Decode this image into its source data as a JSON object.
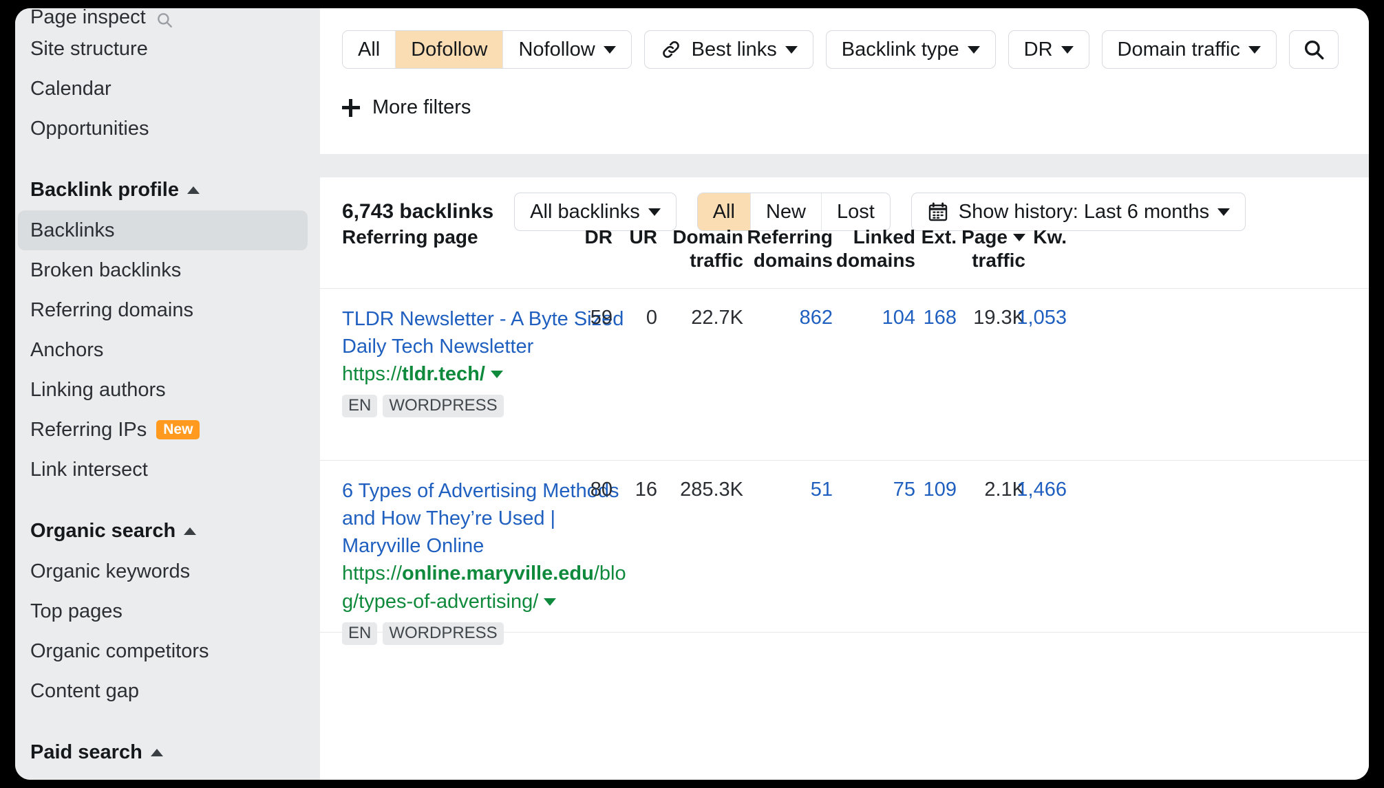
{
  "sidebar": {
    "items": [
      {
        "label": "Page inspect",
        "icon": "search-icon",
        "type": "item",
        "partial": true
      },
      {
        "label": "Site structure",
        "type": "item"
      },
      {
        "label": "Calendar",
        "type": "item"
      },
      {
        "label": "Opportunities",
        "type": "item"
      },
      {
        "label": "Backlink profile",
        "type": "header",
        "expanded": true
      },
      {
        "label": "Backlinks",
        "type": "item",
        "active": true
      },
      {
        "label": "Broken backlinks",
        "type": "item"
      },
      {
        "label": "Referring domains",
        "type": "item"
      },
      {
        "label": "Anchors",
        "type": "item"
      },
      {
        "label": "Linking authors",
        "type": "item"
      },
      {
        "label": "Referring IPs",
        "type": "item",
        "badge": "New"
      },
      {
        "label": "Link intersect",
        "type": "item"
      },
      {
        "label": "Organic search",
        "type": "header",
        "expanded": true
      },
      {
        "label": "Organic keywords",
        "type": "item"
      },
      {
        "label": "Top pages",
        "type": "item"
      },
      {
        "label": "Organic competitors",
        "type": "item"
      },
      {
        "label": "Content gap",
        "type": "item"
      },
      {
        "label": "Paid search",
        "type": "header",
        "expanded": true
      }
    ]
  },
  "filters": {
    "follow_segments": [
      {
        "label": "All",
        "selected": false
      },
      {
        "label": "Dofollow",
        "selected": true
      },
      {
        "label": "Nofollow",
        "selected": false,
        "caret": true
      }
    ],
    "best_links": {
      "label": "Best links",
      "icon": "link-icon",
      "caret": true
    },
    "backlink_type": {
      "label": "Backlink type",
      "caret": true
    },
    "dr": {
      "label": "DR",
      "caret": true
    },
    "domain_traffic": {
      "label": "Domain traffic",
      "caret": true
    },
    "search_button": {
      "icon": "search-icon"
    },
    "more_filters": {
      "label": "More filters",
      "icon": "plus-icon"
    }
  },
  "table_toolbar": {
    "count_label": "6,743 backlinks",
    "scope_dropdown": {
      "label": "All backlinks",
      "caret": true
    },
    "state_segments": [
      {
        "label": "All",
        "selected": true
      },
      {
        "label": "New",
        "selected": false
      },
      {
        "label": "Lost",
        "selected": false
      }
    ],
    "history_dropdown": {
      "label": "Show history: Last 6 months",
      "icon": "calendar-icon",
      "caret": true
    }
  },
  "table": {
    "columns": [
      {
        "key": "referring_page",
        "label": "Referring page",
        "align": "left"
      },
      {
        "key": "dr",
        "label": "DR",
        "align": "right"
      },
      {
        "key": "ur",
        "label": "UR",
        "align": "right"
      },
      {
        "key": "domain_traffic",
        "label": "Domain traffic",
        "align": "right"
      },
      {
        "key": "referring_domains",
        "label": "Referring domains",
        "align": "right"
      },
      {
        "key": "linked_domains",
        "label": "Linked domains",
        "align": "right"
      },
      {
        "key": "ext",
        "label": "Ext.",
        "align": "right"
      },
      {
        "key": "page_traffic",
        "label": "Page traffic",
        "align": "right",
        "sorted": true,
        "sort_dir": "desc"
      },
      {
        "key": "kw",
        "label": "Kw.",
        "align": "right"
      }
    ],
    "rows": [
      {
        "title": "TLDR Newsletter - A Byte Sized Daily Tech Newsletter",
        "url_prefix": "https://",
        "url_domain": "tldr.tech/",
        "url_path": "",
        "tags": [
          "EN",
          "WORDPRESS"
        ],
        "dr": "59",
        "ur": "0",
        "domain_traffic": "22.7K",
        "referring_domains": "862",
        "linked_domains": "104",
        "ext": "168",
        "page_traffic": "19.3K",
        "kw": "1,053"
      },
      {
        "title": "6 Types of Advertising Methods and How They’re Used | Maryville Online",
        "url_prefix": "https://",
        "url_domain": "online.maryville.edu",
        "url_path": "/blog/types-of-advertising/",
        "tags": [
          "EN",
          "WORDPRESS"
        ],
        "dr": "80",
        "ur": "16",
        "domain_traffic": "285.3K",
        "referring_domains": "51",
        "linked_domains": "75",
        "ext": "109",
        "page_traffic": "2.1K",
        "kw": "1,466"
      }
    ]
  },
  "colors": {
    "accent_selected": "#fbddb4",
    "badge_new": "#ff9a1f",
    "link_blue": "#1f5fbf",
    "url_green": "#0f8a3c",
    "sidebar_bg": "#eaecee"
  }
}
